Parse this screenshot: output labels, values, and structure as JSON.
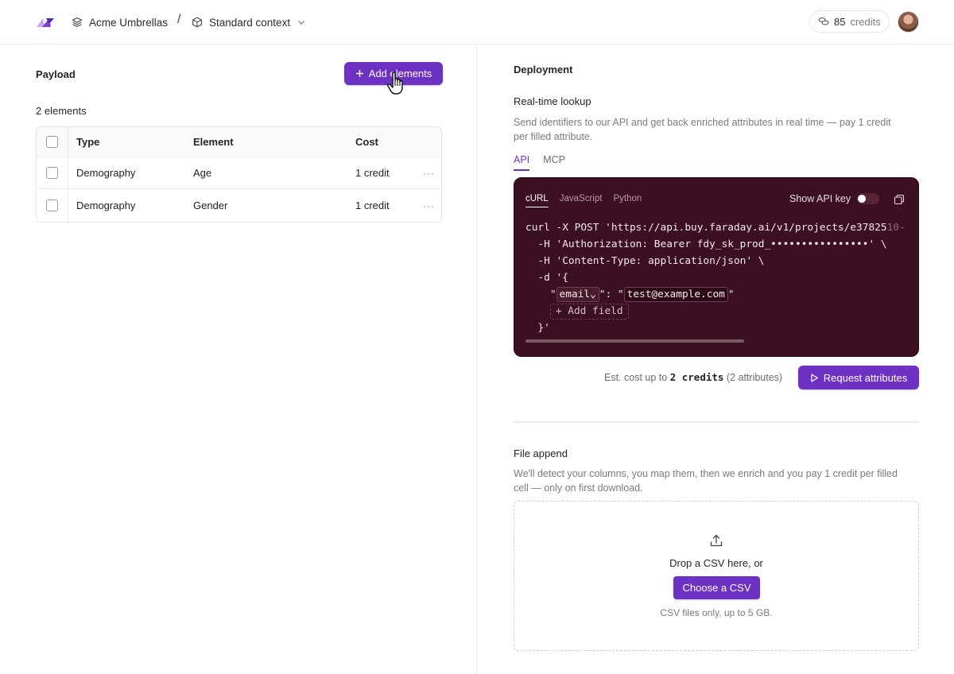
{
  "header": {
    "brand": "Acme Umbrellas",
    "separator": "/",
    "context": "Standard context",
    "credits_value": "85",
    "credits_unit": "credits"
  },
  "payload": {
    "title": "Payload",
    "add_button": "Add elements",
    "count_label": "2 elements",
    "columns": [
      "Type",
      "Element",
      "Cost"
    ],
    "rows": [
      {
        "type": "Demography",
        "element": "Age",
        "cost": "1 credit"
      },
      {
        "type": "Demography",
        "element": "Gender",
        "cost": "1 credit"
      }
    ]
  },
  "deployment": {
    "title": "Deployment",
    "realtime": {
      "title": "Real-time lookup",
      "desc_line1": "Send identifiers to our API and get back enriched attributes in real time — pay 1 credit",
      "desc_line2": "per filled attribute.",
      "tabs": [
        "API",
        "MCP"
      ],
      "active_tab": "API",
      "code_tabs": [
        "cURL",
        "JavaScript",
        "Python"
      ],
      "active_code_tab": "cURL",
      "show_api_key": "Show API key",
      "code": {
        "line1_main": "curl -X POST 'https://api.buy.faraday.ai/v1/projects/e37825",
        "line1_fade": "10-",
        "line2": "  -H 'Authorization: Bearer fdy_sk_prod_••••••••••••••••' \\",
        "line3": "  -H 'Content-Type: application/json' \\",
        "line4": "  -d '{",
        "field_key": "email",
        "field_value": "test@example.com",
        "add_field": "+ Add field",
        "line_close": "  }'"
      },
      "est_prefix": "Est. cost up to",
      "est_value": "2 credits",
      "est_suffix": "(2 attributes)",
      "request_button": "Request attributes"
    },
    "file_append": {
      "title": "File append",
      "desc_line1": "We'll detect your columns, you map them, then we enrich and you pay 1 credit per filled",
      "desc_line2": "cell — only on first download.",
      "drop_text": "Drop a CSV here, or",
      "choose_button": "Choose a CSV",
      "hint": "CSV files only, up to 5 GB."
    }
  },
  "colors": {
    "accent": "#6d32c4",
    "code_bg": "#3d0f22"
  }
}
